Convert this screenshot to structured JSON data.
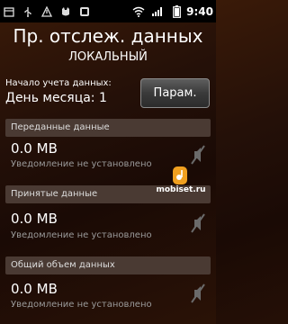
{
  "status_bar": {
    "left_icons": [
      "box-icon",
      "usb-icon",
      "debug-icon",
      "cat-icon",
      "app-icon"
    ],
    "time": "9:40"
  },
  "header": {
    "title": "Пр. отслеж. данных",
    "subtitle": "ЛОКАЛЬНЫЙ"
  },
  "start": {
    "label": "Начало учета данных:",
    "value": "День месяца: 1",
    "params_button": "Парам."
  },
  "sections": [
    {
      "header": "Переданные данные",
      "value": "0.0 MB",
      "note": "Уведомление не установлено"
    },
    {
      "header": "Принятые данные",
      "value": "0.0 MB",
      "note": "Уведомление не установлено"
    },
    {
      "header": "Общий объем данных",
      "value": "0.0 MB",
      "note": "Уведомление не установлено"
    }
  ],
  "watermark": "mobiset.ru",
  "colors": {
    "section_header_bg": "#4a3a33",
    "note_text": "#9a9a9a",
    "logo_orange": "#f0a020"
  }
}
